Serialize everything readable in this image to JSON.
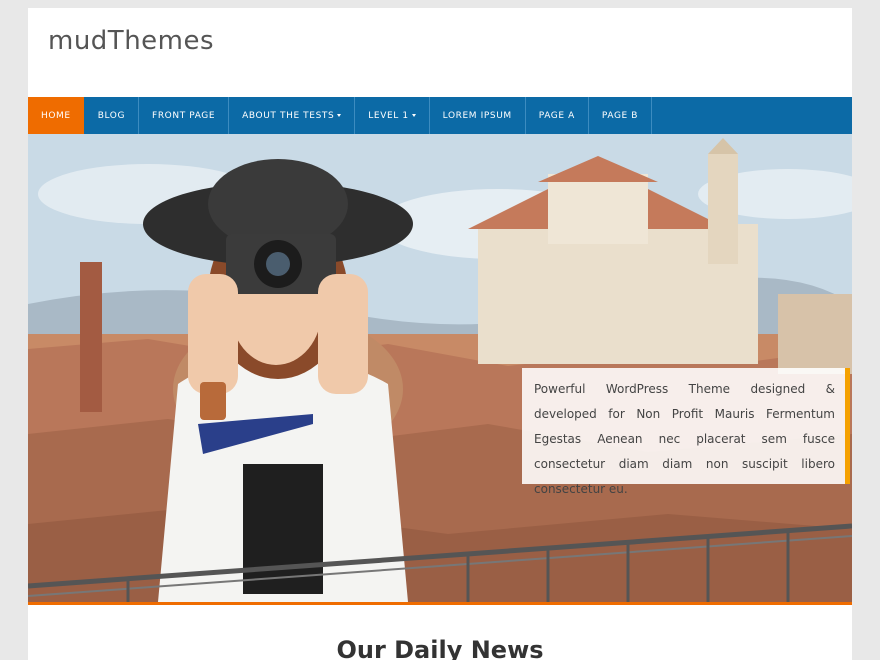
{
  "site": {
    "title": "mudThemes"
  },
  "nav": {
    "items": [
      {
        "label": "HOME",
        "active": true,
        "dropdown": false
      },
      {
        "label": "BLOG",
        "active": false,
        "dropdown": false
      },
      {
        "label": "FRONT PAGE",
        "active": false,
        "dropdown": false
      },
      {
        "label": "ABOUT THE TESTS",
        "active": false,
        "dropdown": true
      },
      {
        "label": "LEVEL 1",
        "active": false,
        "dropdown": true
      },
      {
        "label": "LOREM IPSUM",
        "active": false,
        "dropdown": false
      },
      {
        "label": "PAGE A",
        "active": false,
        "dropdown": false
      },
      {
        "label": "PAGE B",
        "active": false,
        "dropdown": false
      }
    ]
  },
  "hero": {
    "image": "photographer-woman-hat-camera",
    "caption": "Powerful WordPress Theme designed & developed for Non Profit Mauris Fermentum Egestas Aenean nec placerat sem fusce consectetur diam diam non suscipit libero consectetur eu."
  },
  "section": {
    "title": "Our Daily News"
  },
  "colors": {
    "nav": "#0c6aa6",
    "accent": "#ef6c00",
    "caption_border": "#f5a100"
  }
}
